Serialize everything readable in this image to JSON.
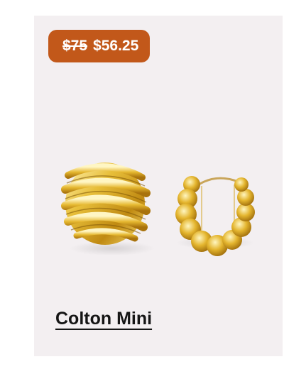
{
  "product": {
    "original_price": "$75",
    "sale_price": "$56.25",
    "name": "Colton Mini",
    "image_icon": "gold-ridged-hoop-earrings"
  },
  "colors": {
    "card_background": "#f3eff1",
    "badge_background": "#c2581a",
    "title_color": "#151515",
    "gold": "#e0b630"
  }
}
